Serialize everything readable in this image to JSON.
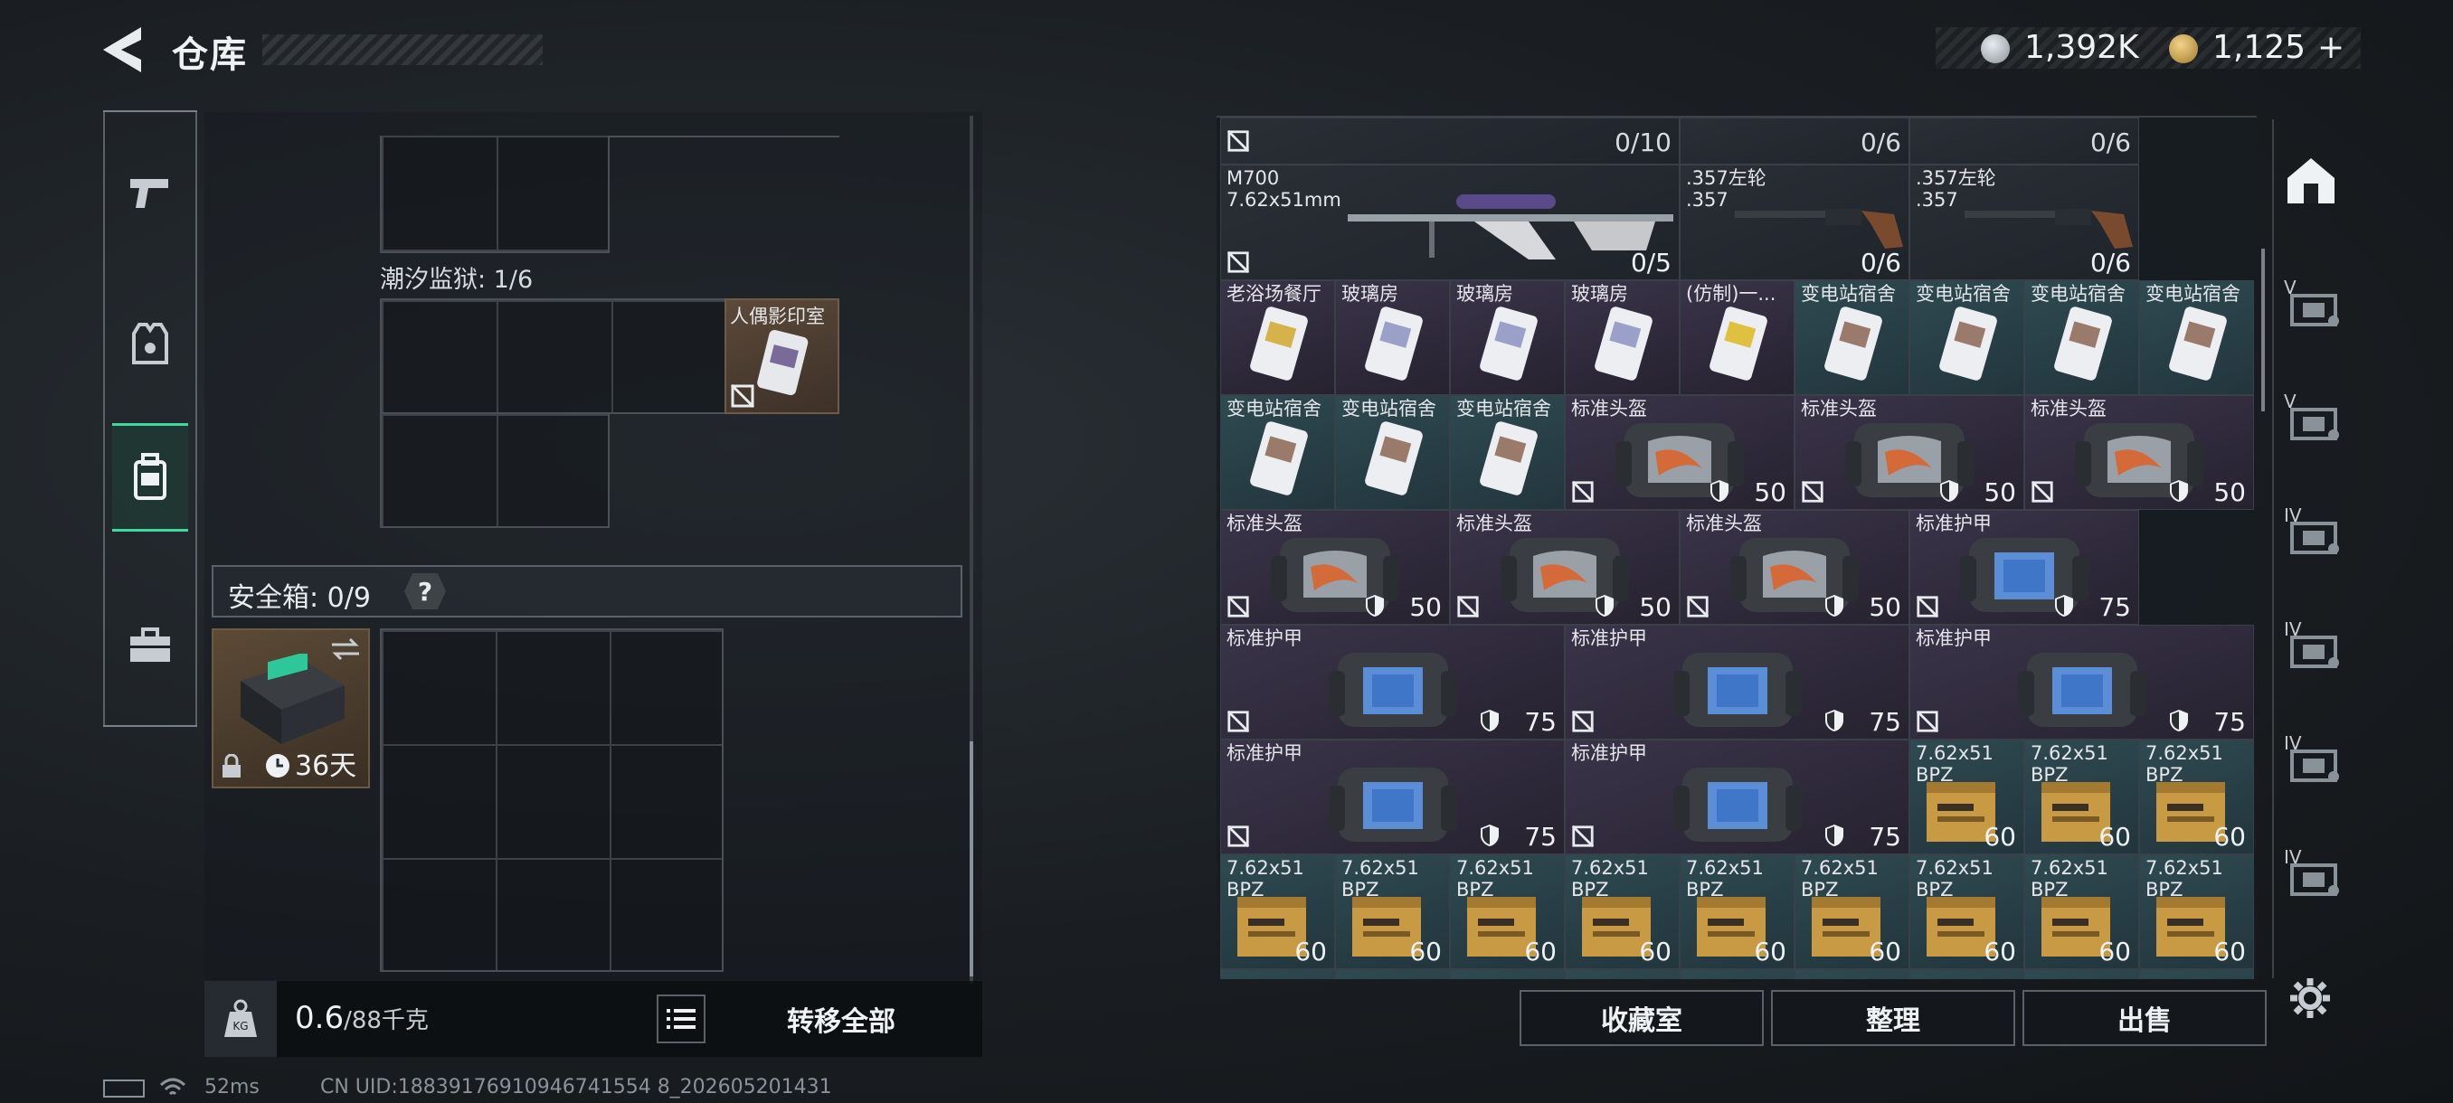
{
  "header": {
    "title": "仓库",
    "currency_silver": "1,392K",
    "currency_gold": "1,125",
    "gold_plus": "+"
  },
  "nav": {
    "items": [
      {
        "name": "weapons",
        "icon": "pistol-icon"
      },
      {
        "name": "gear",
        "icon": "vest-icon"
      },
      {
        "name": "backpack",
        "icon": "backpack-icon",
        "active": true
      },
      {
        "name": "case",
        "icon": "briefcase-icon"
      }
    ]
  },
  "loadout": {
    "section_label": "潮汐监狱: 1/6",
    "item_name": "人偶影印室",
    "safe_box_label": "安全箱: 0/9",
    "help": "?",
    "container_timer": "36天"
  },
  "footer_left": {
    "weight_current": "0.6",
    "weight_max": "/88千克",
    "transfer_all": "转移全部"
  },
  "status": {
    "ping": "52ms",
    "uid": "CN UID:18839176910946741554 8_202605201431"
  },
  "stash": {
    "row0": {
      "c1": "0/10",
      "c2": "0/6",
      "c3": "0/6"
    },
    "row1": [
      {
        "name": "M700",
        "sub": "7.62x51mm",
        "count": "0/5"
      },
      {
        "name": ".357左轮",
        "sub": ".357",
        "count": "0/6"
      },
      {
        "name": ".357左轮",
        "sub": ".357",
        "count": "0/6"
      }
    ],
    "row2": [
      "老浴场餐厅",
      "玻璃房",
      "玻璃房",
      "玻璃房",
      "(仿制)一...",
      "变电站宿舍",
      "变电站宿舍",
      "变电站宿舍",
      "变电站宿舍"
    ],
    "row3_keys": [
      "变电站宿舍",
      "变电站宿舍",
      "变电站宿舍"
    ],
    "row3_helmets": [
      {
        "name": "标准头盔",
        "value": "50"
      },
      {
        "name": "标准头盔",
        "value": "50"
      },
      {
        "name": "标准头盔",
        "value": "50"
      }
    ],
    "row4": [
      {
        "name": "标准头盔",
        "value": "50"
      },
      {
        "name": "标准头盔",
        "value": "50"
      },
      {
        "name": "标准头盔",
        "value": "50"
      },
      {
        "name": "标准护甲",
        "value": "75"
      }
    ],
    "row5": [
      {
        "name": "标准护甲",
        "value": "75"
      },
      {
        "name": "标准护甲",
        "value": "75"
      },
      {
        "name": "标准护甲",
        "value": "75"
      }
    ],
    "row6_armor": [
      {
        "name": "标准护甲",
        "value": "75"
      },
      {
        "name": "标准护甲",
        "value": "75"
      }
    ],
    "ammo": {
      "name": "7.62x51",
      "sub": "BPZ",
      "value": "60"
    },
    "actions": {
      "collection": "收藏室",
      "sort": "整理",
      "sell": "出售"
    }
  },
  "rail": {
    "labels": [
      "V",
      "V",
      "IV",
      "IV",
      "IV",
      "IV"
    ]
  }
}
